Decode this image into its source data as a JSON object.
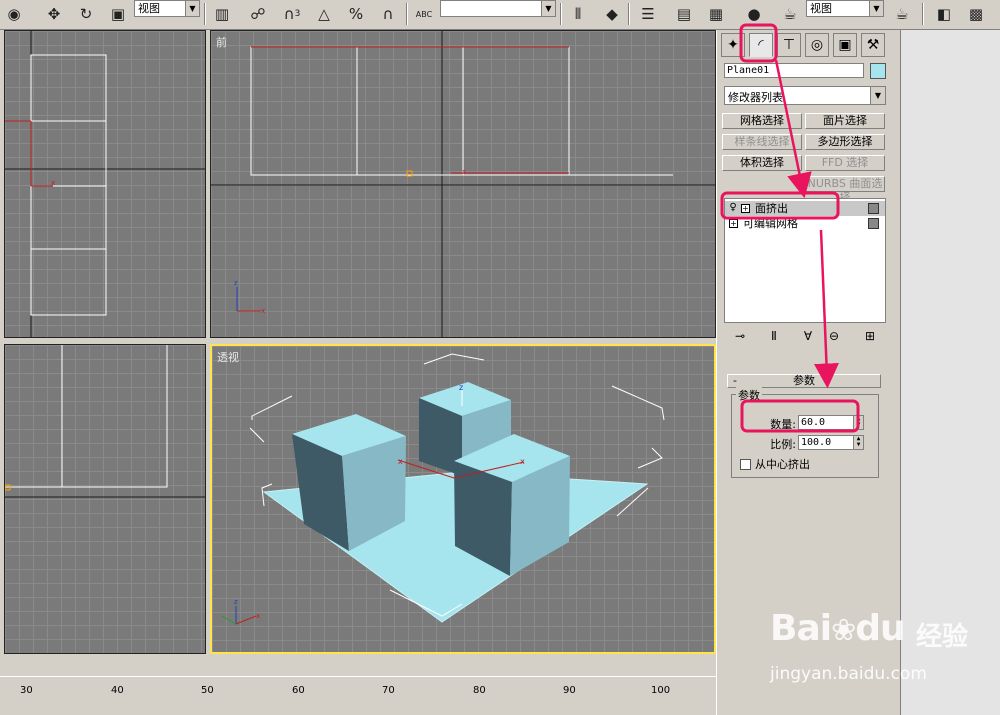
{
  "toolbar": {
    "view_dropdown_1": "视图",
    "view_dropdown_2": "视图",
    "icons": [
      "select-object-icon",
      "move-icon",
      "rotate-icon",
      "scale-icon",
      "select-region-icon",
      "snap-3-icon",
      "angle-snap-icon",
      "percent-snap-icon",
      "spinner-snap-icon",
      "named-selection-icon",
      "mirror-icon",
      "align-icon",
      "layer-icon",
      "curve-editor-icon",
      "schematic-icon",
      "material-editor-icon",
      "render-setup-icon",
      "quick-render-icon"
    ],
    "snap_label": "3",
    "text_label": "ABC"
  },
  "viewports": {
    "top_left": {
      "label": ""
    },
    "front": {
      "label": "前"
    },
    "left": {
      "label": ""
    },
    "perspective": {
      "label": "透视"
    }
  },
  "ruler": {
    "ticks": [
      "30",
      "40",
      "50",
      "60",
      "70",
      "80",
      "90",
      "100"
    ]
  },
  "command_panel": {
    "tabs": [
      "create-tab",
      "modify-tab",
      "hierarchy-tab",
      "motion-tab",
      "display-tab",
      "utilities-tab"
    ],
    "object_name": "Plane01",
    "object_color": "#a6e4ee",
    "modifier_list": "修改器列表",
    "modifier_buttons": [
      {
        "label": "网格选择",
        "disabled": false
      },
      {
        "label": "面片选择",
        "disabled": false
      },
      {
        "label": "样条线选择",
        "disabled": true
      },
      {
        "label": "多边形选择",
        "disabled": false
      },
      {
        "label": "体积选择",
        "disabled": false
      },
      {
        "label": "FFD 选择",
        "disabled": true
      },
      {
        "label": "NURBS 曲面选择",
        "disabled": true
      }
    ],
    "stack": [
      {
        "label": "面挤出",
        "selected": true
      },
      {
        "label": "可编辑网格",
        "selected": false
      }
    ],
    "rollout": {
      "title": "参数",
      "collapse_symbol": "-",
      "group_title": "参数",
      "amount_label": "数量:",
      "amount_value": "60.0",
      "scale_label": "比例:",
      "scale_value": "100.0",
      "from_center_label": "从中心挤出"
    }
  },
  "colors": {
    "highlight": "#e8155e",
    "active_viewport_border": "#ffe44c",
    "box_fill": "#a6e4ee"
  },
  "watermark": {
    "logo": "Bai",
    "logo_suffix": "du",
    "brand_text": "经验",
    "url": "jingyan.baidu.com"
  }
}
